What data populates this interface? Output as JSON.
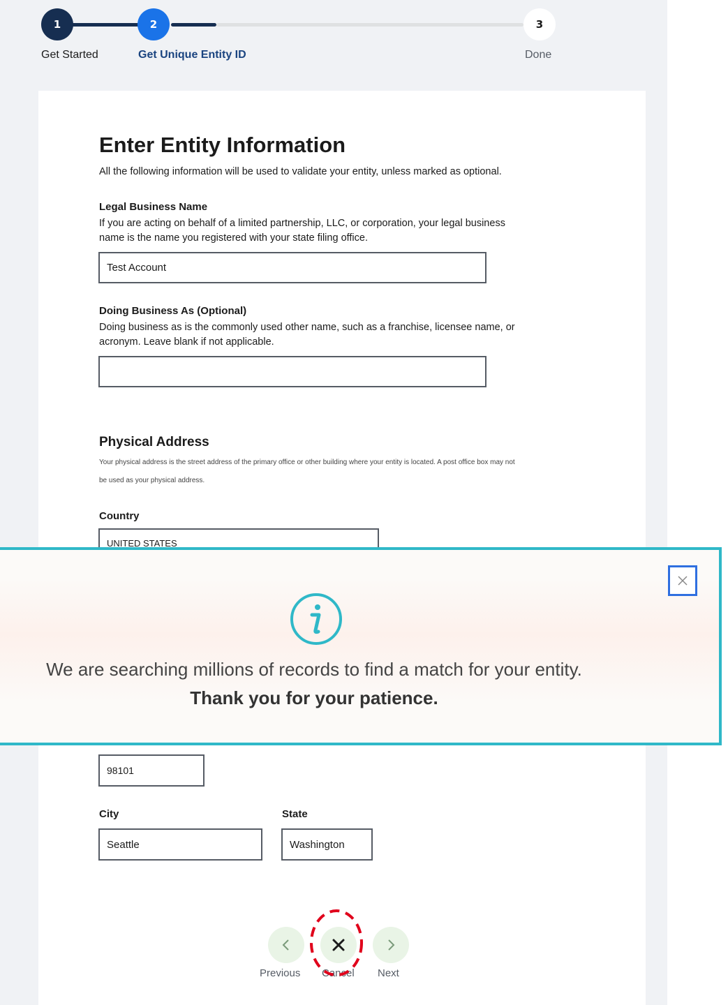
{
  "stepper": {
    "steps": [
      {
        "number": "1",
        "label": "Get Started",
        "state": "complete"
      },
      {
        "number": "2",
        "label": "Get Unique Entity ID",
        "state": "current"
      },
      {
        "number": "3",
        "label": "Done",
        "state": "upcoming"
      }
    ],
    "colors": {
      "complete": "#162e51",
      "current": "#1a73e8",
      "upcoming_bg": "#ffffff"
    }
  },
  "form": {
    "title": "Enter Entity Information",
    "lead": "All the following information will be used to validate your entity, unless marked as optional.",
    "legal_name": {
      "label": "Legal Business Name",
      "hint": "If you are acting on behalf of a limited partnership, LLC, or corporation, your legal business name is the name you registered with your state filing office.",
      "value": "Test Account"
    },
    "dba": {
      "label": "Doing Business As (Optional)",
      "hint": "Doing business as is the commonly used other name, such as a franchise, licensee name, or acronym. Leave blank if not applicable.",
      "value": ""
    },
    "physical_address": {
      "title": "Physical Address",
      "hint": "Your physical address is the street address of the primary office or other building where your entity is located. A post office box may not be used as your physical address."
    },
    "country": {
      "label": "Country",
      "value": "UNITED STATES"
    },
    "zip": {
      "value": "98101"
    },
    "city": {
      "label": "City",
      "value": "Seattle"
    },
    "state": {
      "label": "State",
      "value": "Washington"
    }
  },
  "banner": {
    "icon": "info-icon",
    "message": "We are searching millions of records to find a match for your entity.",
    "thanks": "Thank you for your patience.",
    "close_icon": "close-icon",
    "accent": "#2fb8c8"
  },
  "nav": {
    "previous": "Previous",
    "cancel": "Cancel",
    "next": "Next",
    "highlight_color": "#e0001b"
  }
}
